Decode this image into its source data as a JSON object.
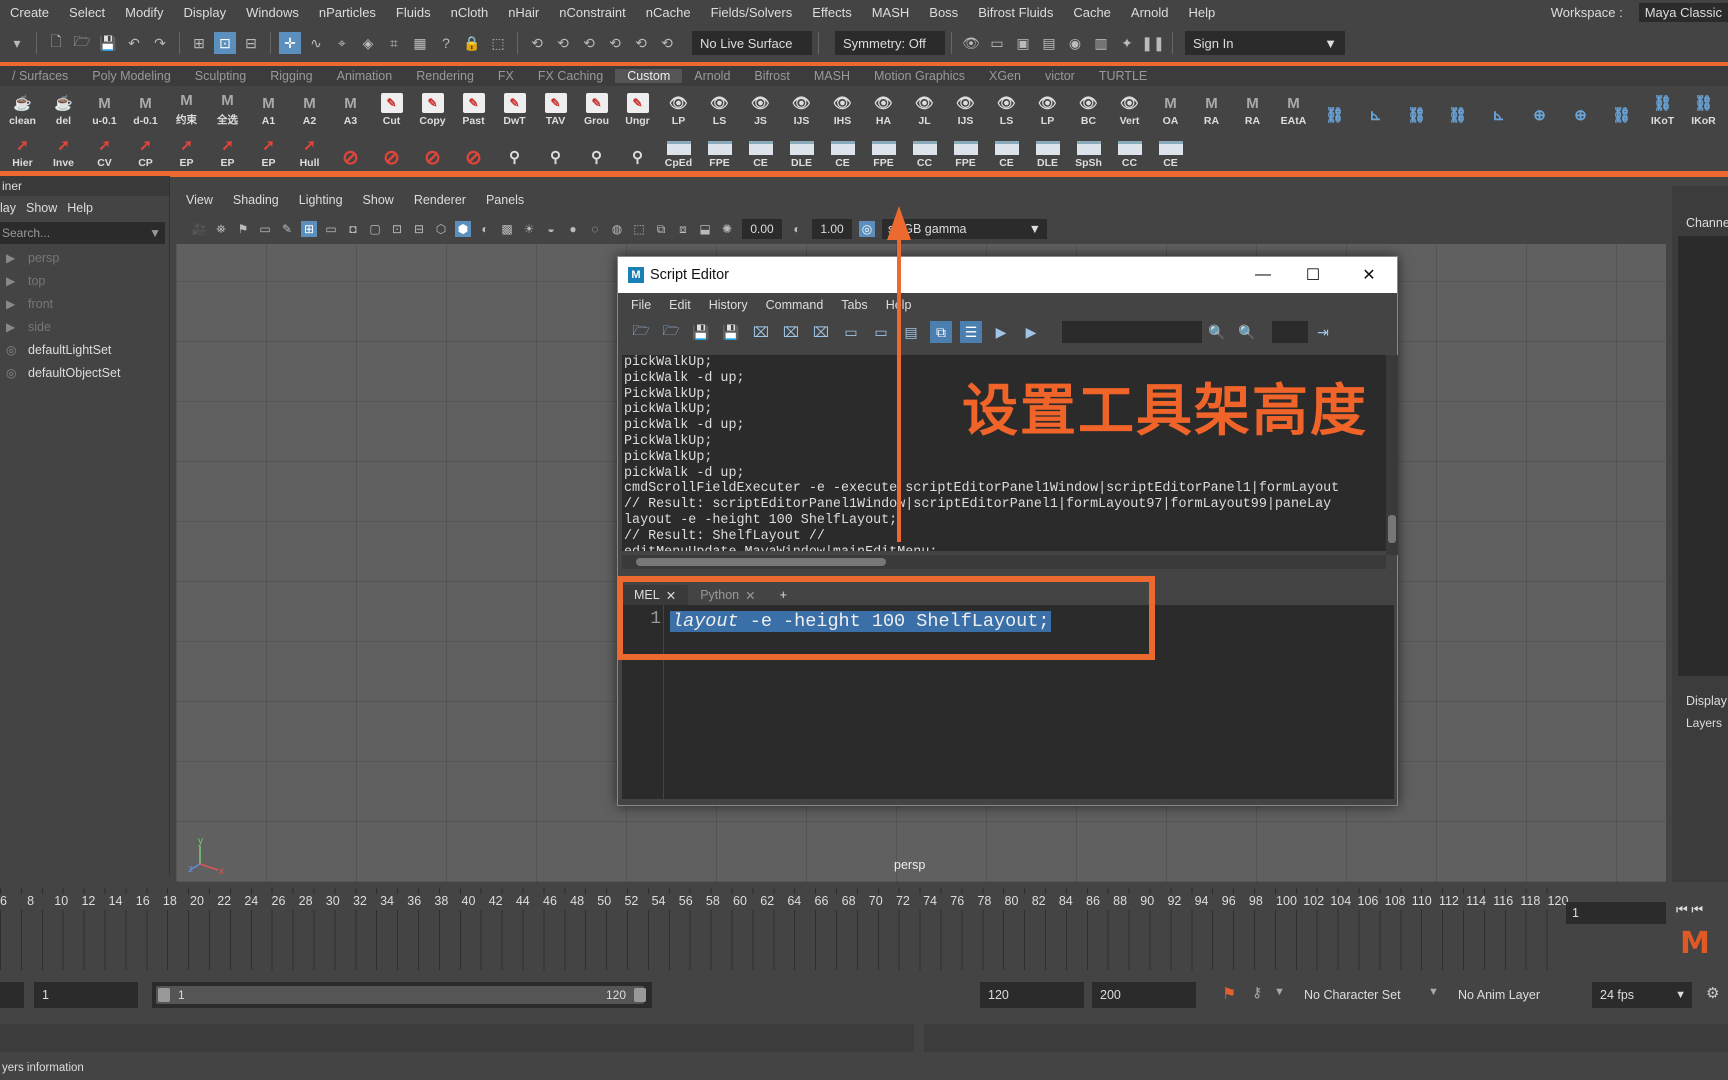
{
  "menubar": {
    "items": [
      "Create",
      "Select",
      "Modify",
      "Display",
      "Windows",
      "nParticles",
      "Fluids",
      "nCloth",
      "nHair",
      "nConstraint",
      "nCache",
      "Fields/Solvers",
      "Effects",
      "MASH",
      "Boss",
      "Bifrost Fluids",
      "Cache",
      "Arnold",
      "Help"
    ],
    "workspace_label": "Workspace :",
    "workspace_value": "Maya Classic"
  },
  "statusline": {
    "live_surface": "No Live Surface",
    "symmetry": "Symmetry: Off",
    "sign_in": "Sign In"
  },
  "shelf_tabs": [
    "/ Surfaces",
    "Poly Modeling",
    "Sculpting",
    "Rigging",
    "Animation",
    "Rendering",
    "FX",
    "FX Caching",
    "Custom",
    "Arnold",
    "Bifrost",
    "MASH",
    "Motion Graphics",
    "XGen",
    "victor",
    "TURTLE"
  ],
  "shelf_active_tab": "Custom",
  "shelf_row1": [
    {
      "label": "clean",
      "icon": "teapot-icon"
    },
    {
      "label": "del",
      "icon": "teapot-icon"
    },
    {
      "label": "u-0.1",
      "icon": "maya-m-icon"
    },
    {
      "label": "d-0.1",
      "icon": "maya-m-icon"
    },
    {
      "label": "约束",
      "icon": "maya-m-icon"
    },
    {
      "label": "全选",
      "icon": "maya-m-icon"
    },
    {
      "label": "A1",
      "icon": "maya-m-icon"
    },
    {
      "label": "A2",
      "icon": "maya-m-icon"
    },
    {
      "label": "A3",
      "icon": "maya-m-icon"
    },
    {
      "label": "Cut",
      "icon": "pen-icon"
    },
    {
      "label": "Copy",
      "icon": "pen-icon"
    },
    {
      "label": "Past",
      "icon": "pen-icon"
    },
    {
      "label": "DwT",
      "icon": "pen-icon"
    },
    {
      "label": "TAV",
      "icon": "pen-icon"
    },
    {
      "label": "Grou",
      "icon": "pen-icon"
    },
    {
      "label": "Ungr",
      "icon": "pen-icon"
    },
    {
      "label": "LP",
      "icon": "eye-icon"
    },
    {
      "label": "LS",
      "icon": "eye-icon"
    },
    {
      "label": "JS",
      "icon": "eye-icon"
    },
    {
      "label": "IJS",
      "icon": "eye-icon"
    },
    {
      "label": "IHS",
      "icon": "eye-icon"
    },
    {
      "label": "HA",
      "icon": "eye-icon"
    },
    {
      "label": "JL",
      "icon": "eye-icon"
    },
    {
      "label": "IJS",
      "icon": "eye-icon"
    },
    {
      "label": "LS",
      "icon": "eye-icon"
    },
    {
      "label": "LP",
      "icon": "eye-icon"
    },
    {
      "label": "BC",
      "icon": "eye-icon"
    },
    {
      "label": "Vert",
      "icon": "eye-icon"
    },
    {
      "label": "OA",
      "icon": "maya-m-icon"
    },
    {
      "label": "RA",
      "icon": "maya-m-icon"
    },
    {
      "label": "RA",
      "icon": "maya-m-icon"
    },
    {
      "label": "EAtA",
      "icon": "maya-m-icon"
    },
    {
      "label": "",
      "icon": "chain-icon"
    },
    {
      "label": "",
      "icon": "axis-icon"
    },
    {
      "label": "",
      "icon": "chain-icon"
    },
    {
      "label": "",
      "icon": "chain-icon"
    },
    {
      "label": "",
      "icon": "axis-icon"
    },
    {
      "label": "",
      "icon": "crosshair-icon"
    },
    {
      "label": "",
      "icon": "crosshair-icon"
    },
    {
      "label": "",
      "icon": "chain-icon"
    },
    {
      "label": "IKoT",
      "icon": "chain-icon"
    },
    {
      "label": "IKoR",
      "icon": "chain-icon"
    }
  ],
  "shelf_row2": [
    {
      "label": "Hier",
      "icon": "select-arrow-icon"
    },
    {
      "label": "Inve",
      "icon": "select-arrow-icon"
    },
    {
      "label": "CV",
      "icon": "select-arrow-icon"
    },
    {
      "label": "CP",
      "icon": "select-arrow-icon"
    },
    {
      "label": "EP",
      "icon": "select-arrow-icon"
    },
    {
      "label": "EP",
      "icon": "select-arrow-icon"
    },
    {
      "label": "EP",
      "icon": "select-arrow-icon"
    },
    {
      "label": "Hull",
      "icon": "select-arrow-icon"
    },
    {
      "label": "",
      "icon": "joint-icon"
    },
    {
      "label": "",
      "icon": "joint-icon"
    },
    {
      "label": "",
      "icon": "joint-icon"
    },
    {
      "label": "",
      "icon": "joint-icon"
    },
    {
      "label": "",
      "icon": "brush-icon"
    },
    {
      "label": "",
      "icon": "brush-icon"
    },
    {
      "label": "",
      "icon": "brush-icon"
    },
    {
      "label": "",
      "icon": "brush-icon"
    },
    {
      "label": "CpEd",
      "icon": "window-icon"
    },
    {
      "label": "FPE",
      "icon": "window-icon"
    },
    {
      "label": "CE",
      "icon": "window-icon"
    },
    {
      "label": "DLE",
      "icon": "window-icon"
    },
    {
      "label": "CE",
      "icon": "window-icon"
    },
    {
      "label": "FPE",
      "icon": "window-icon"
    },
    {
      "label": "CC",
      "icon": "window-icon"
    },
    {
      "label": "FPE",
      "icon": "window-icon"
    },
    {
      "label": "CE",
      "icon": "window-icon"
    },
    {
      "label": "DLE",
      "icon": "window-icon"
    },
    {
      "label": "SpSh",
      "icon": "window-icon"
    },
    {
      "label": "CC",
      "icon": "window-icon"
    },
    {
      "label": "CE",
      "icon": "window-icon"
    }
  ],
  "outliner": {
    "title": "iner",
    "menu": [
      "lay",
      "Show",
      "Help"
    ],
    "search_placeholder": "Search...",
    "items": [
      {
        "label": "persp",
        "lit": false
      },
      {
        "label": "top",
        "lit": false
      },
      {
        "label": "front",
        "lit": false
      },
      {
        "label": "side",
        "lit": false
      },
      {
        "label": "defaultLightSet",
        "lit": true
      },
      {
        "label": "defaultObjectSet",
        "lit": true
      }
    ]
  },
  "viewport": {
    "menu": [
      "View",
      "Shading",
      "Lighting",
      "Show",
      "Renderer",
      "Panels"
    ],
    "exposure": "0.00",
    "gamma": "1.00",
    "color_space": "sRGB gamma",
    "camera_label": "persp"
  },
  "channel_box": {
    "label": "Channe",
    "display_label": "Display",
    "layers_label": "Layers"
  },
  "script_editor": {
    "title": "Script Editor",
    "menu": [
      "File",
      "Edit",
      "History",
      "Command",
      "Tabs",
      "Help"
    ],
    "history_lines": [
      "pickWalkUp;",
      "pickWalk -d up;",
      "PickWalkUp;",
      "pickWalkUp;",
      "pickWalk -d up;",
      "PickWalkUp;",
      "pickWalkUp;",
      "pickWalk -d up;",
      "cmdScrollFieldExecuter -e -execute scriptEditorPanel1Window|scriptEditorPanel1|formLayout",
      "// Result: scriptEditorPanel1Window|scriptEditorPanel1|formLayout97|formLayout99|paneLay",
      "layout -e -height 100 ShelfLayout;",
      "// Result: ShelfLayout //",
      "editMenuUpdate MayaWindow|mainEditMenu;"
    ],
    "tabs": [
      {
        "label": "MEL",
        "active": true
      },
      {
        "label": "Python",
        "active": false
      }
    ],
    "add_tab": "+",
    "line_number": "1",
    "input_keyword": "layout",
    "input_rest": " -e -height 100 ShelfLayout;"
  },
  "annotation": {
    "text": "设置工具架高度",
    "color": "#ec6a30"
  },
  "timeline": {
    "ticks": [
      "6",
      "8",
      "10",
      "12",
      "14",
      "16",
      "18",
      "20",
      "22",
      "24",
      "26",
      "28",
      "30",
      "32",
      "34",
      "36",
      "38",
      "40",
      "42",
      "44",
      "46",
      "48",
      "50",
      "52",
      "54",
      "56",
      "58",
      "60",
      "62",
      "64",
      "66",
      "68",
      "70",
      "72",
      "74",
      "76",
      "78",
      "80",
      "82",
      "84",
      "86",
      "88",
      "90",
      "92",
      "94",
      "96",
      "98",
      "100",
      "102",
      "104",
      "106",
      "108",
      "110",
      "112",
      "114",
      "116",
      "118",
      "120"
    ],
    "current_frame": "1",
    "logo": "M"
  },
  "range": {
    "start": "1",
    "slider_start": "1",
    "slider_end": "120",
    "end": "120",
    "anim_end": "200",
    "character_set": "No Character Set",
    "anim_layer": "No Anim Layer",
    "fps": "24 fps"
  },
  "helpline": "yers information"
}
